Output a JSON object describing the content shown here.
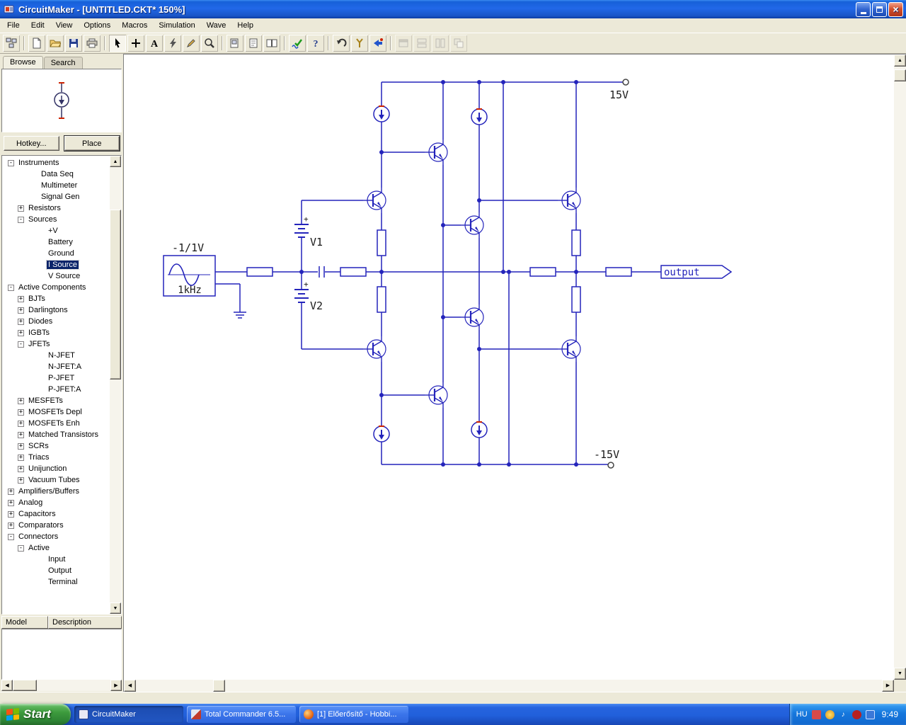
{
  "window": {
    "title": "CircuitMaker - [UNTITLED.CKT* 150%]"
  },
  "menu": {
    "items": [
      "File",
      "Edit",
      "View",
      "Options",
      "Macros",
      "Simulation",
      "Wave",
      "Help"
    ]
  },
  "toolbar": {
    "buttons": [
      "browse-panel",
      "new-file",
      "open-file",
      "save-file",
      "print",
      "select-tool",
      "wire-tool",
      "text-tool",
      "delete-tool",
      "edit-tool",
      "zoom-tool",
      "zoom-fit",
      "zoom-sheet",
      "split-view",
      "analysis-check",
      "help",
      "undo",
      "probe-tool",
      "run-simulation",
      "arrange-window-1",
      "arrange-window-2",
      "arrange-window-3",
      "arrange-window-4"
    ]
  },
  "sidebar": {
    "tabs": [
      {
        "label": "Browse"
      },
      {
        "label": "Search"
      }
    ],
    "hotkey_button": "Hotkey...",
    "place_button": "Place",
    "model_header": "Model",
    "description_header": "Description",
    "tree": {
      "items": [
        {
          "label": "Instruments",
          "pad": 8,
          "box": "-"
        },
        {
          "label": "Data Seq",
          "pad": 40,
          "box": ""
        },
        {
          "label": "Multimeter",
          "pad": 40,
          "box": ""
        },
        {
          "label": "Signal Gen",
          "pad": 40,
          "box": ""
        },
        {
          "label": "Resistors",
          "pad": 22,
          "box": "+"
        },
        {
          "label": "Sources",
          "pad": 22,
          "box": "-"
        },
        {
          "label": "+V",
          "pad": 50,
          "box": ""
        },
        {
          "label": "Battery",
          "pad": 50,
          "box": ""
        },
        {
          "label": "Ground",
          "pad": 50,
          "box": ""
        },
        {
          "label": "I Source",
          "pad": 50,
          "box": "",
          "selected": true
        },
        {
          "label": "V Source",
          "pad": 50,
          "box": ""
        },
        {
          "label": "Active Components",
          "pad": 8,
          "box": "-"
        },
        {
          "label": "BJTs",
          "pad": 22,
          "box": "+"
        },
        {
          "label": "Darlingtons",
          "pad": 22,
          "box": "+"
        },
        {
          "label": "Diodes",
          "pad": 22,
          "box": "+"
        },
        {
          "label": "IGBTs",
          "pad": 22,
          "box": "+"
        },
        {
          "label": "JFETs",
          "pad": 22,
          "box": "-"
        },
        {
          "label": "N-JFET",
          "pad": 50,
          "box": ""
        },
        {
          "label": "N-JFET:A",
          "pad": 50,
          "box": ""
        },
        {
          "label": "P-JFET",
          "pad": 50,
          "box": ""
        },
        {
          "label": "P-JFET:A",
          "pad": 50,
          "box": ""
        },
        {
          "label": "MESFETs",
          "pad": 22,
          "box": "+"
        },
        {
          "label": "MOSFETs Depl",
          "pad": 22,
          "box": "+"
        },
        {
          "label": "MOSFETs Enh",
          "pad": 22,
          "box": "+"
        },
        {
          "label": "Matched Transistors",
          "pad": 22,
          "box": "+"
        },
        {
          "label": "SCRs",
          "pad": 22,
          "box": "+"
        },
        {
          "label": "Triacs",
          "pad": 22,
          "box": "+"
        },
        {
          "label": "Unijunction",
          "pad": 22,
          "box": "+"
        },
        {
          "label": "Vacuum Tubes",
          "pad": 22,
          "box": "+"
        },
        {
          "label": "Amplifiers/Buffers",
          "pad": 8,
          "box": "+"
        },
        {
          "label": "Analog",
          "pad": 8,
          "box": "+"
        },
        {
          "label": "Capacitors",
          "pad": 8,
          "box": "+"
        },
        {
          "label": "Comparators",
          "pad": 8,
          "box": "+"
        },
        {
          "label": "Connectors",
          "pad": 8,
          "box": "-"
        },
        {
          "label": "Active",
          "pad": 22,
          "box": "-"
        },
        {
          "label": "Input",
          "pad": 50,
          "box": ""
        },
        {
          "label": "Output",
          "pad": 50,
          "box": ""
        },
        {
          "label": "Terminal",
          "pad": 50,
          "box": ""
        }
      ]
    }
  },
  "canvas": {
    "labels": {
      "vplus": "15V",
      "vminus": "-15V",
      "v1": "V1",
      "v2": "V2",
      "source_amplitude": "-1/1V",
      "source_freq": "1kHz",
      "output": "output"
    }
  },
  "taskbar": {
    "start": "Start",
    "tasks": [
      {
        "label": "CircuitMaker",
        "active": true
      },
      {
        "label": "Total Commander 6.5...",
        "active": false
      },
      {
        "label": "[1] Előerősítő - Hobbi...",
        "active": false
      }
    ],
    "tray": {
      "language": "HU",
      "time": "9:49"
    }
  },
  "colors": {
    "circuit": "#2424bb",
    "selection": "#0A246A",
    "taskbar": "#2663de"
  }
}
